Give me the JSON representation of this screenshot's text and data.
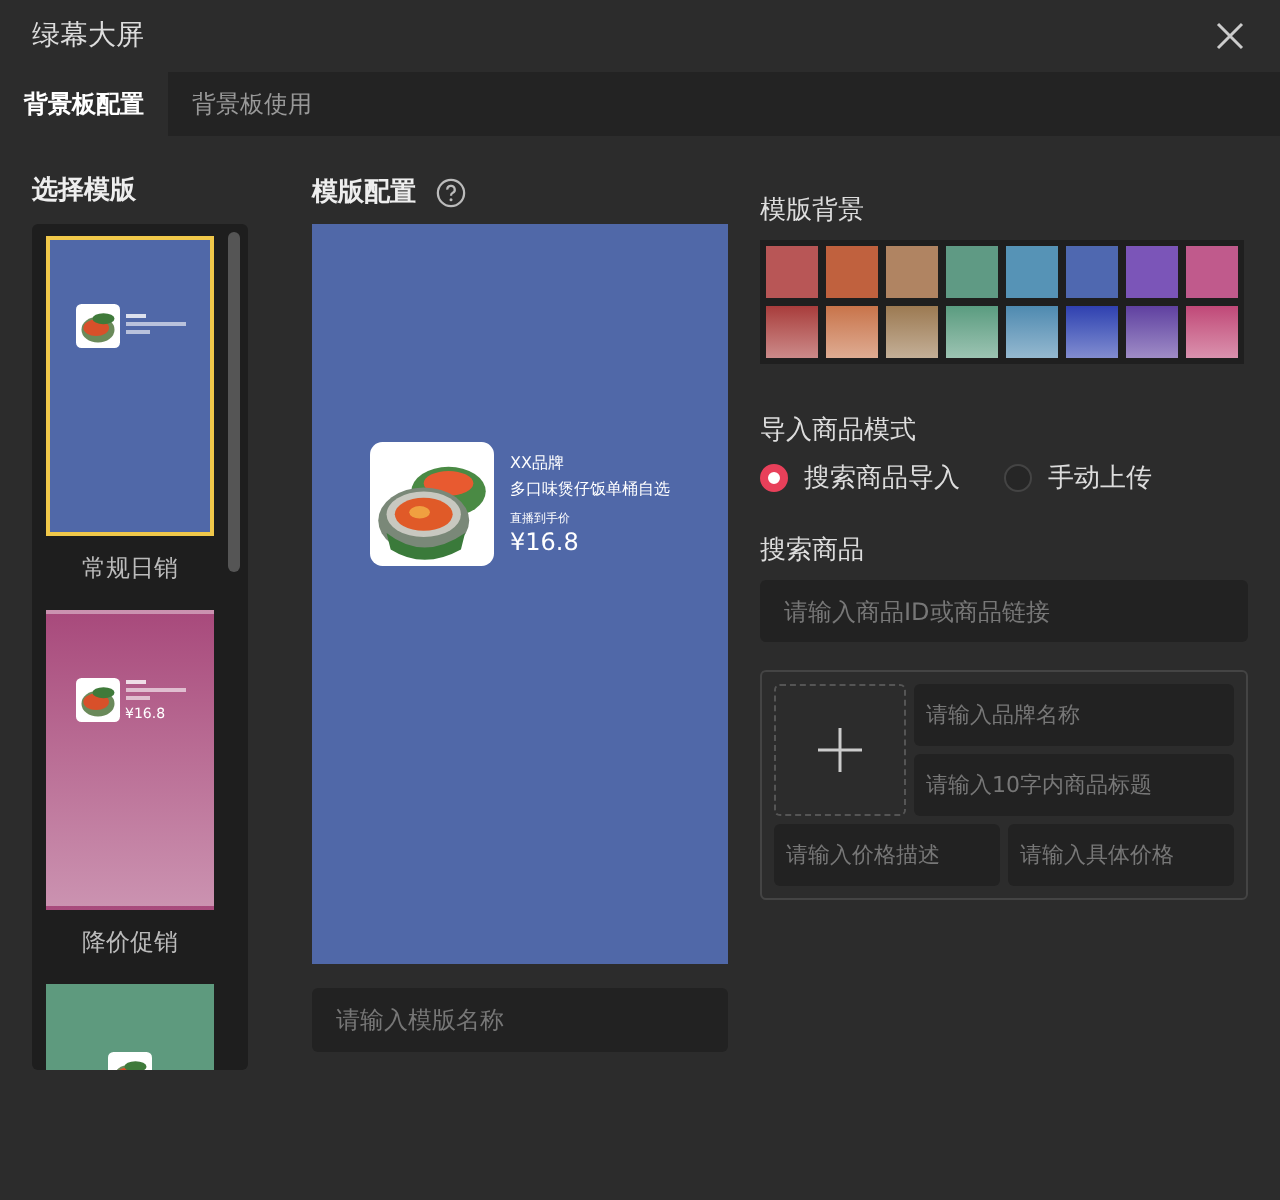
{
  "window": {
    "title": "绿幕大屏"
  },
  "tabs": [
    {
      "label": "背景板配置",
      "selected": true
    },
    {
      "label": "背景板使用",
      "selected": false
    }
  ],
  "template_list": {
    "heading": "选择模版",
    "templates": [
      {
        "name": "常规日销",
        "color": "#5068a8",
        "kind": "solid",
        "selected": true
      },
      {
        "name": "降价促销",
        "color": "#a84a7c",
        "kind": "gradient",
        "selected": false,
        "price": "¥16.8"
      },
      {
        "color": "#5e9a7e",
        "kind": "solid",
        "selected": false,
        "cut_off": true
      }
    ]
  },
  "config": {
    "heading": "模版配置",
    "product": {
      "brand": "XX品牌",
      "title": "多口味煲仔饭单桶自选",
      "price_label": "直播到手价",
      "price": "¥16.8"
    },
    "name_placeholder": "请输入模版名称"
  },
  "background": {
    "heading": "模版背景",
    "swatches": [
      {
        "color": "#b85656"
      },
      {
        "color": "#c0613e"
      },
      {
        "color": "#b08462"
      },
      {
        "color": "#5f9a84"
      },
      {
        "color": "#5693b6"
      },
      {
        "color": "#4f68b0"
      },
      {
        "color": "#7b55b8"
      },
      {
        "color": "#c05a8c"
      }
    ],
    "gradients": [
      {
        "color": "#a83c3c"
      },
      {
        "color": "#c8744a"
      },
      {
        "color": "#9c7a52"
      },
      {
        "color": "#5a9c80"
      },
      {
        "color": "#4e8ab0"
      },
      {
        "color": "#3040b0"
      },
      {
        "color": "#6040a0"
      },
      {
        "color": "#c04878"
      }
    ]
  },
  "import_mode": {
    "heading": "导入商品模式",
    "options": [
      {
        "label": "搜索商品导入",
        "selected": true
      },
      {
        "label": "手动上传",
        "selected": false
      }
    ]
  },
  "search": {
    "heading": "搜索商品",
    "placeholder": "请输入商品ID或商品链接"
  },
  "manual": {
    "brand_placeholder": "请输入品牌名称",
    "title_placeholder": "请输入10字内商品标题",
    "price_desc_placeholder": "请输入价格描述",
    "price_placeholder": "请输入具体价格"
  }
}
